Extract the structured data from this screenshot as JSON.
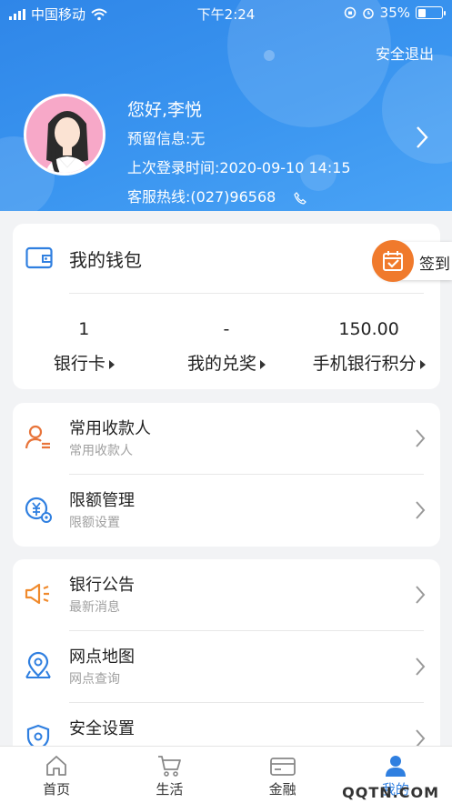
{
  "status_bar": {
    "carrier": "中国移动",
    "time": "下午2:24",
    "battery": "35%",
    "battery_level": 0.35
  },
  "header": {
    "logout_label": "安全退出",
    "greeting": "您好,李悦",
    "reserved_info": "预留信息:无",
    "last_login": "上次登录时间:2020-09-10 14:15",
    "hotline": "客服热线:(027)96568"
  },
  "wallet": {
    "title": "我的钱包",
    "stats": [
      {
        "value": "1",
        "label": "银行卡"
      },
      {
        "value": "-",
        "label": "我的兑奖"
      },
      {
        "value": "150.00",
        "label": "手机银行积分"
      }
    ]
  },
  "signin": {
    "label": "签到"
  },
  "menu_group_1": [
    {
      "title": "常用收款人",
      "subtitle": "常用收款人",
      "icon": "payee-icon"
    },
    {
      "title": "限额管理",
      "subtitle": "限额设置",
      "icon": "limit-icon"
    }
  ],
  "menu_group_2": [
    {
      "title": "银行公告",
      "subtitle": "最新消息",
      "icon": "megaphone-icon"
    },
    {
      "title": "网点地图",
      "subtitle": "网点查询",
      "icon": "map-pin-icon"
    },
    {
      "title": "安全设置",
      "subtitle": "",
      "icon": "shield-icon"
    }
  ],
  "tabbar": {
    "tabs": [
      {
        "label": "首页",
        "icon": "home-icon"
      },
      {
        "label": "生活",
        "icon": "cart-icon"
      },
      {
        "label": "金融",
        "icon": "card-icon"
      },
      {
        "label": "我的",
        "icon": "user-icon"
      }
    ],
    "active_index": 3
  },
  "watermark": "QQTN.COM",
  "colors": {
    "header_blue": "#3a95f0",
    "accent_orange": "#f07a2c",
    "icon_blue": "#2f7fe0",
    "page_bg": "#f2f3f5"
  }
}
